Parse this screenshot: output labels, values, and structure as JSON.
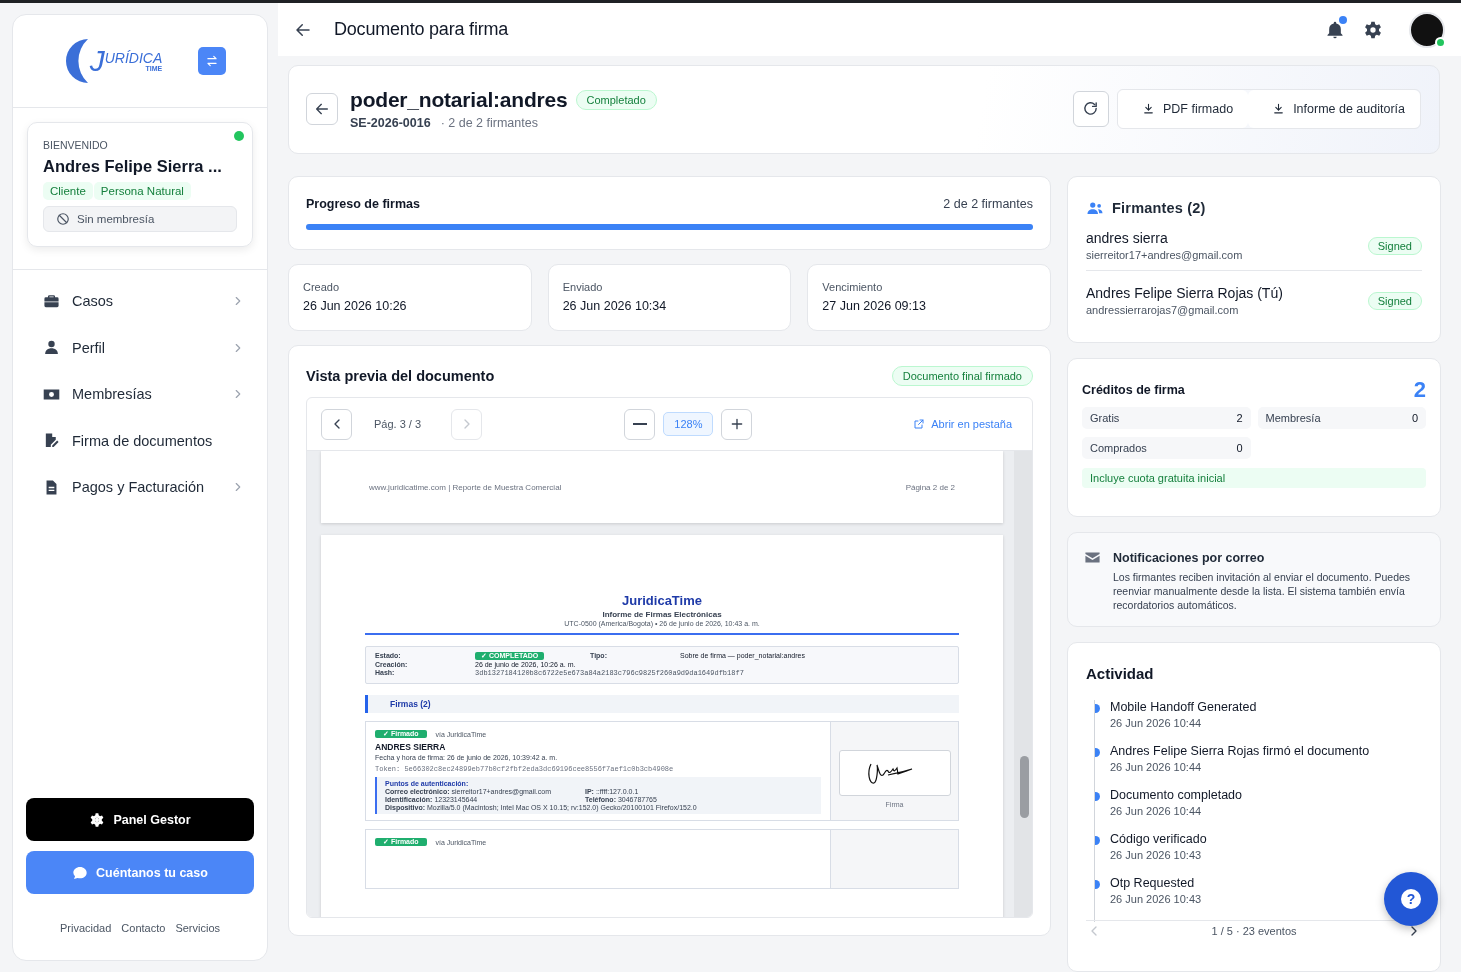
{
  "sidebar": {
    "logo": {
      "mark": "J",
      "name": "URÍDICA",
      "sub": "TIME"
    },
    "welcome": {
      "label": "BIENVENIDO",
      "name": "Andres Felipe Sierra ...",
      "online": true,
      "tags": [
        "Cliente",
        "Persona Natural"
      ],
      "membership": "Sin membresía"
    },
    "nav": [
      {
        "label": "Casos",
        "expandable": true
      },
      {
        "label": "Perfil",
        "expandable": true
      },
      {
        "label": "Membresías",
        "expandable": true
      },
      {
        "label": "Firma de documentos",
        "expandable": false
      },
      {
        "label": "Pagos y Facturación",
        "expandable": true
      }
    ],
    "buttons": [
      {
        "label": "Panel Gestor",
        "kind": "dark"
      },
      {
        "label": "Cuéntanos tu caso",
        "kind": "primary"
      }
    ],
    "footer_links": [
      "Privacidad",
      "Contacto",
      "Servicios"
    ]
  },
  "topbar": {
    "title": "Documento para firma",
    "notification_dot": true,
    "online": true
  },
  "document": {
    "title": "poder_notarial:andres",
    "status": "Completado",
    "code": "SE-2026-0016",
    "signers_summary": "· 2 de 2 firmantes",
    "actions": [
      "PDF firmado",
      "Informe de auditoría"
    ]
  },
  "progress": {
    "label": "Progreso de firmas",
    "summary": "2 de 2 firmantes",
    "level": 1
  },
  "dates": [
    {
      "label": "Creado",
      "value": "26 Jun 2026 10:26"
    },
    {
      "label": "Enviado",
      "value": "26 Jun 2026 10:34"
    },
    {
      "label": "Vencimiento",
      "value": "27 Jun 2026 09:13"
    }
  ],
  "preview": {
    "title": "Vista previa del documento",
    "badge": "Documento final firmado",
    "page": "Pág. 3 / 3",
    "prev_disabled": false,
    "next_disabled": true,
    "zoom": "128%",
    "open_tab": "Abrir en pestaña",
    "previous_page_footer": {
      "left": "www.juridicatime.com | Reporte de Muestra Comercial",
      "right": "Página 2 de 2"
    },
    "report": {
      "brand": "JuridicaTime",
      "title": "Informe de Firmas Electrónicas",
      "subtitle": "UTC-0500 (America/Bogota) • 26 de junio de 2026, 10:43 a. m.",
      "summary": [
        [
          {
            "label": "Estado:",
            "value": "✓ COMPLETADO",
            "kind": "badge"
          },
          {
            "label": "Tipo:",
            "value": "Sobre de firma — poder_notarial:andres",
            "kind": "text"
          }
        ],
        [
          {
            "label": "Creación:",
            "value": "26 de junio de 2026, 10:26 a. m.",
            "kind": "text"
          }
        ],
        [
          {
            "label": "Hash:",
            "value": "3db1327184120b8c6722e5e673a84a2183c796c9825f260a9d9da1649dfb18f7",
            "kind": "mono"
          }
        ]
      ],
      "section": "Firmas (2)",
      "signatures": [
        {
          "status": "✓ Firmado",
          "via": "vía JuridicaTime",
          "name": "ANDRES SIERRA",
          "date": "Fecha y hora de firma: 26 de junio de 2026, 10:39:42 a. m.",
          "token": "Token: 5e66302c8ec24899eb77b0cf2fbf2eda3dc69196cee8556f7aef1c0b3cb4908e",
          "auth_title": "Puntos de autenticación:",
          "auth": [
            "**Correo electrónico:** sierreitor17+andres@gmail.com",
            "**IP:** ::ffff:127.0.0.1",
            "**Identificación:** 12323145644",
            "**Teléfono:** 3046787765",
            "**Dispositivo:** Mozilla/5.0 (Macintosh; Intel Mac OS X 10.15; rv:152.0) Gecko/20100101 Firefox/152.0"
          ],
          "caption": "Firma"
        },
        {
          "status": "✓ Firmado",
          "via": "vía JuridicaTime"
        }
      ]
    }
  },
  "signers": {
    "title": "Firmantes (2)",
    "items": [
      {
        "name": "andres sierra",
        "email": "sierreitor17+andres@gmail.com",
        "status": "Signed"
      },
      {
        "name": "Andres Felipe Sierra Rojas (Tú)",
        "email": "andressierrarojas7@gmail.com",
        "status": "Signed"
      }
    ]
  },
  "credits": {
    "title": "Créditos de firma",
    "total": "2",
    "items": [
      {
        "label": "Gratis",
        "value": "2"
      },
      {
        "label": "Membresía",
        "value": "0"
      },
      {
        "label": "Comprados",
        "value": "0"
      }
    ],
    "note": "Incluye cuota gratuita inicial"
  },
  "notifications": {
    "title": "Notificaciones por correo",
    "text": "Los firmantes reciben invitación al enviar el documento. Puedes reenviar manualmente desde la lista. El sistema también envía recordatorios automáticos."
  },
  "activity": {
    "title": "Actividad",
    "events": [
      {
        "text": "Mobile Handoff Generated",
        "time": "26 Jun 2026 10:44"
      },
      {
        "text": "Andres Felipe Sierra Rojas firmó el documento",
        "time": "26 Jun 2026 10:44"
      },
      {
        "text": "Documento completado",
        "time": "26 Jun 2026 10:44"
      },
      {
        "text": "Código verificado",
        "time": "26 Jun 2026 10:43"
      },
      {
        "text": "Otp Requested",
        "time": "26 Jun 2026 10:43"
      }
    ],
    "pager": "1 / 5 · 23 eventos",
    "prev_disabled": true,
    "next_disabled": false
  },
  "help": {
    "label": "?"
  }
}
